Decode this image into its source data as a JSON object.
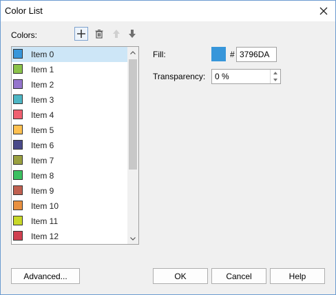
{
  "dialog": {
    "title": "Color List",
    "colors_label": "Colors:",
    "fill_label": "Fill:",
    "hash": "#",
    "fill_hex": "3796DA",
    "transparency_label": "Transparency:",
    "transparency_value": "0 %"
  },
  "toolbar": [
    "add-icon",
    "delete-icon",
    "move-up-icon",
    "move-down-icon"
  ],
  "colors": {
    "accent_selection": "#cde6f7",
    "fill": "#3796DA"
  },
  "items": [
    {
      "label": "Item 0",
      "color": "#3796DA"
    },
    {
      "label": "Item 1",
      "color": "#8BC34A"
    },
    {
      "label": "Item 2",
      "color": "#9575CD"
    },
    {
      "label": "Item 3",
      "color": "#4DB6C4"
    },
    {
      "label": "Item 4",
      "color": "#F06070"
    },
    {
      "label": "Item 5",
      "color": "#FFC050"
    },
    {
      "label": "Item 6",
      "color": "#4A4A8A"
    },
    {
      "label": "Item 7",
      "color": "#9AA040"
    },
    {
      "label": "Item 8",
      "color": "#3CC060"
    },
    {
      "label": "Item 9",
      "color": "#C06050"
    },
    {
      "label": "Item 10",
      "color": "#E89040"
    },
    {
      "label": "Item 11",
      "color": "#C8D828"
    },
    {
      "label": "Item 12",
      "color": "#D04050"
    }
  ],
  "selected_index": 0,
  "buttons": {
    "advanced": "Advanced...",
    "ok": "OK",
    "cancel": "Cancel",
    "help": "Help"
  }
}
